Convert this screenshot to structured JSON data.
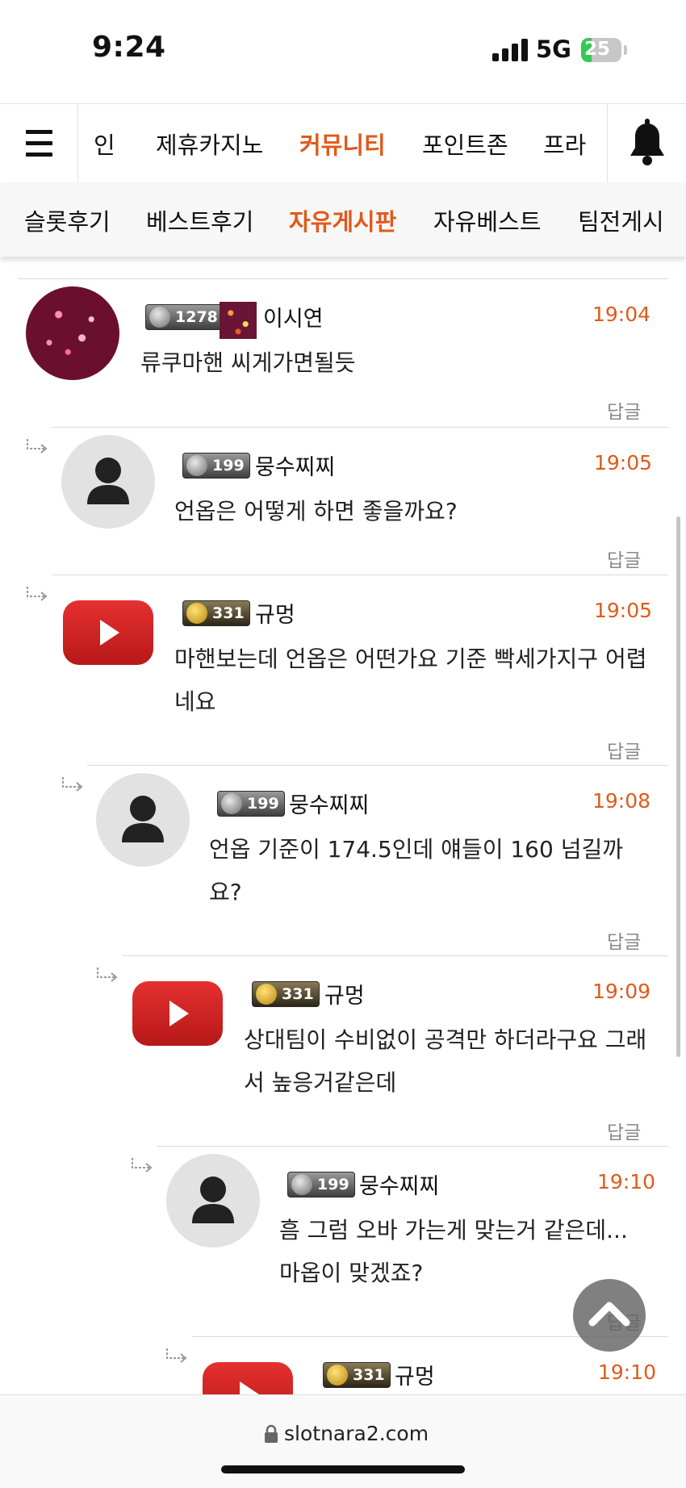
{
  "status_bar": {
    "time": "9:24",
    "network": "5G",
    "battery": "25",
    "battery_level": 0.25
  },
  "main_nav": {
    "items": [
      "인",
      "제휴카지노",
      "커뮤니티",
      "포인트존",
      "프라"
    ],
    "active": "커뮤니티"
  },
  "sub_nav": {
    "items": [
      "슬롯후기",
      "베스트후기",
      "자유게시판",
      "자유베스트",
      "팀전게시"
    ],
    "active": "자유게시판"
  },
  "comments": [
    {
      "level": "1278",
      "nick": "이시연",
      "time": "19:04",
      "text": "류쿠마핸 씨게가면될듯",
      "reply": "답글"
    },
    {
      "level": "199",
      "nick": "뭉수찌찌",
      "time": "19:05",
      "text": "언옵은 어떻게 하면 좋을까요?",
      "reply": "답글"
    },
    {
      "level": "331",
      "nick": "규멍",
      "time": "19:05",
      "text": "마핸보는데 언옵은 어떤가요 기준 빡세가지구 어렵네요",
      "reply": "답글"
    },
    {
      "level": "199",
      "nick": "뭉수찌찌",
      "time": "19:08",
      "text": "언옵 기준이 174.5인데 얘들이 160 넘길까요?",
      "reply": "답글"
    },
    {
      "level": "331",
      "nick": "규멍",
      "time": "19:09",
      "text": "상대팀이 수비없이 공격만 하더라구요 그래서 높응거같은데",
      "reply": "답글"
    },
    {
      "level": "199",
      "nick": "뭉수찌찌",
      "time": "19:10",
      "text": "흠 그럼 오바 가는게 맞는거 같은데... 마옵이 맞겠죠?",
      "reply": "답글"
    },
    {
      "level": "331",
      "nick": "규멍",
      "time": "19:10"
    }
  ],
  "browser": {
    "url": "slotnara2.com"
  }
}
